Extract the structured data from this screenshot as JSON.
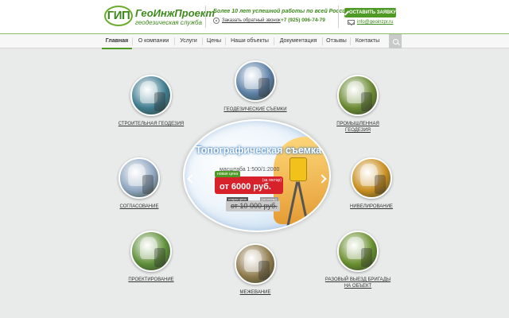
{
  "header": {
    "logo_mark": "ГИП",
    "logo_name": "ГеоИнжПроект",
    "logo_sub": "геодезическая служба",
    "slogan": "Более 10 лет успешной работы по всей России!",
    "callback_label": "Заказать обратный звонок",
    "phone": "+7 (925) 006-74-79",
    "cta_label": "ОСТАВИТЬ ЗАЯВКУ",
    "email": "info@geoinzpr.ru"
  },
  "nav": {
    "items": [
      "Главная",
      "О компании",
      "Услуги",
      "Цены",
      "Наши объекты",
      "Документация",
      "Отзывы",
      "Контакты"
    ],
    "active": "Главная"
  },
  "services": [
    {
      "label": "СТРОИТЕЛЬНАЯ ГЕОДЕЗИЯ",
      "color": "#3f7c8f"
    },
    {
      "label": "ГЕОДЕЗИЧЕСКИЕ СЪЕМКИ",
      "color": "#5b7fa5"
    },
    {
      "label": "ПРОМЫШЛЕННАЯ ГЕОДЕЗИЯ",
      "color": "#6b8a34"
    },
    {
      "label": "СОГЛАСОВАНИЕ",
      "color": "#8fa6bf"
    },
    {
      "label": "НИВЕЛИРОВАНИЕ",
      "color": "#c98e1d"
    },
    {
      "label": "ПРОЕКТИРОВАНИЕ",
      "color": "#5f8f3a"
    },
    {
      "label": "МЕЖЕВАНИЕ",
      "color": "#8e7a4c"
    },
    {
      "label": "РАЗОВЫЙ ВЫЕЗД БРИГАДЫ НА ОБЪЕКТ",
      "color": "#6a8f2f"
    }
  ],
  "slide": {
    "title": "Топографическая съемка",
    "scale": "масштаба 1:500/1:2000",
    "new_price_label": "новая цена",
    "price_unit": "(за гектар)",
    "price": "от 6000 руб.",
    "old_price_label": "старая цена",
    "old_price_unit": "(за гектар)",
    "old_price": "от 10 000 руб."
  },
  "colors": {
    "brand_green": "#4f9a26",
    "price_red": "#d8222b"
  }
}
